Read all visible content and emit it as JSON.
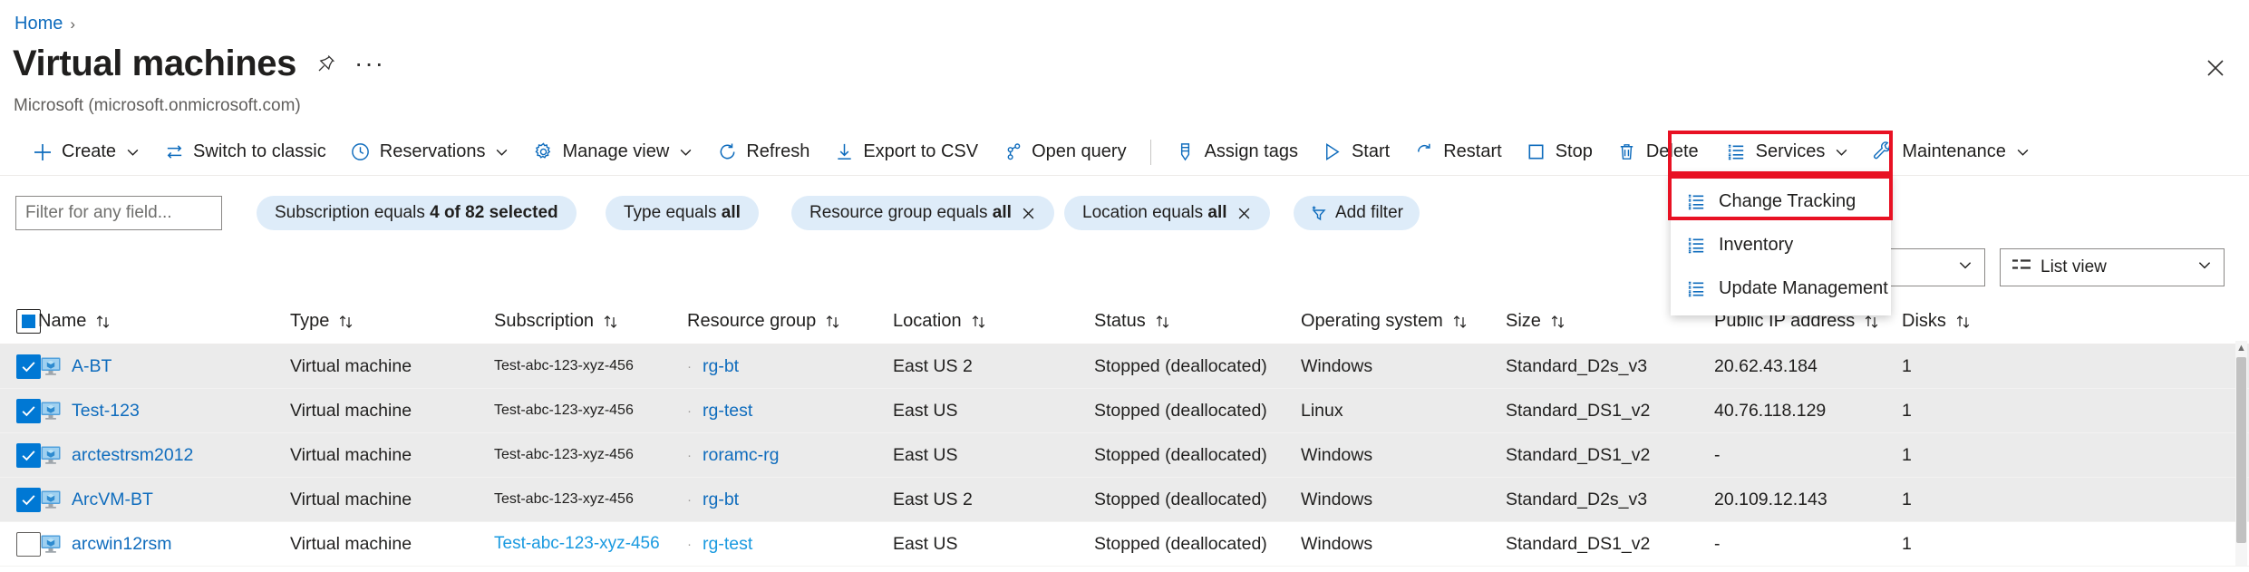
{
  "breadcrumb": {
    "home": "Home",
    "separator": "›"
  },
  "header": {
    "title": "Virtual machines",
    "subtitle": "Microsoft (microsoft.onmicrosoft.com)",
    "pin_icon": "pin-icon",
    "more_icon": "ellipsis-icon",
    "close_icon": "close-icon"
  },
  "toolbar": {
    "items": [
      {
        "label": "Create",
        "icon": "plus-icon",
        "chevron": true
      },
      {
        "label": "Switch to classic",
        "icon": "switch-icon",
        "chevron": false
      },
      {
        "label": "Reservations",
        "icon": "clock-icon",
        "chevron": true
      },
      {
        "label": "Manage view",
        "icon": "gear-icon",
        "chevron": true
      },
      {
        "label": "Refresh",
        "icon": "refresh-icon",
        "chevron": false
      },
      {
        "label": "Export to CSV",
        "icon": "download-icon",
        "chevron": false
      },
      {
        "label": "Open query",
        "icon": "query-icon",
        "chevron": false
      },
      {
        "label": "Assign tags",
        "icon": "tag-icon",
        "chevron": false
      },
      {
        "label": "Start",
        "icon": "play-icon",
        "chevron": false
      },
      {
        "label": "Restart",
        "icon": "restart-icon",
        "chevron": false
      },
      {
        "label": "Stop",
        "icon": "stop-icon",
        "chevron": false
      },
      {
        "label": "Delete",
        "icon": "trash-icon",
        "chevron": false
      },
      {
        "label": "Services",
        "icon": "list-icon",
        "chevron": true
      },
      {
        "label": "Maintenance",
        "icon": "wrench-icon",
        "chevron": true
      }
    ]
  },
  "services_menu": {
    "open": true,
    "highlight_color": "#e81123",
    "items": [
      {
        "label": "Change Tracking",
        "icon": "list-icon",
        "highlighted": true
      },
      {
        "label": "Inventory",
        "icon": "list-icon",
        "highlighted": false
      },
      {
        "label": "Update Management",
        "icon": "list-icon",
        "highlighted": false
      }
    ]
  },
  "filters": {
    "search_placeholder": "Filter for any field...",
    "search_value": "",
    "pills": [
      {
        "prefix": "Subscription equals ",
        "value": "4 of 82 selected",
        "removable": false
      },
      {
        "prefix": "Type equals ",
        "value": "all",
        "removable": false
      },
      {
        "prefix": "Resource group equals ",
        "value": "all",
        "removable": true
      },
      {
        "prefix": "Location equals ",
        "value": "all",
        "removable": true
      }
    ],
    "add_filter_label": "Add filter"
  },
  "view_controls": {
    "group_by": {
      "value": "",
      "icon": "chevron-down-icon"
    },
    "list_view": {
      "value": "List view",
      "icon": "list-view-icon"
    }
  },
  "table": {
    "select_all_state": "indeterminate",
    "columns": [
      {
        "key": "name",
        "label": "Name"
      },
      {
        "key": "type",
        "label": "Type"
      },
      {
        "key": "sub",
        "label": "Subscription"
      },
      {
        "key": "rg",
        "label": "Resource group"
      },
      {
        "key": "loc",
        "label": "Location"
      },
      {
        "key": "stat",
        "label": "Status"
      },
      {
        "key": "os",
        "label": "Operating system"
      },
      {
        "key": "size",
        "label": "Size"
      },
      {
        "key": "ip",
        "label": "Public IP address"
      },
      {
        "key": "disk",
        "label": "Disks"
      }
    ],
    "rows": [
      {
        "selected": true,
        "name": "A-BT",
        "type": "Virtual machine",
        "sub": "Test-abc-123-xyz-456",
        "rg": "rg-bt",
        "loc": "East US 2",
        "stat": "Stopped (deallocated)",
        "os": "Windows",
        "size": "Standard_D2s_v3",
        "ip": "20.62.43.184",
        "disk": "1"
      },
      {
        "selected": true,
        "name": "Test-123",
        "type": "Virtual machine",
        "sub": "Test-abc-123-xyz-456",
        "rg": "rg-test",
        "loc": "East US",
        "stat": "Stopped (deallocated)",
        "os": "Linux",
        "size": "Standard_DS1_v2",
        "ip": "40.76.118.129",
        "disk": "1"
      },
      {
        "selected": true,
        "name": "arctestrsm2012",
        "type": "Virtual machine",
        "sub": "Test-abc-123-xyz-456",
        "rg": "roramc-rg",
        "loc": "East US",
        "stat": "Stopped (deallocated)",
        "os": "Windows",
        "size": "Standard_DS1_v2",
        "ip": "-",
        "disk": "1"
      },
      {
        "selected": true,
        "name": "ArcVM-BT",
        "type": "Virtual machine",
        "sub": "Test-abc-123-xyz-456",
        "rg": "rg-bt",
        "loc": "East US 2",
        "stat": "Stopped (deallocated)",
        "os": "Windows",
        "size": "Standard_D2s_v3",
        "ip": "20.109.12.143",
        "disk": "1"
      },
      {
        "selected": false,
        "name": "arcwin12rsm",
        "type": "Virtual machine",
        "sub": "Test-abc-123-xyz-456",
        "rg": "rg-test",
        "loc": "East US",
        "stat": "Stopped (deallocated)",
        "os": "Windows",
        "size": "Standard_DS1_v2",
        "ip": "-",
        "disk": "1"
      }
    ]
  },
  "colors": {
    "accent": "#0078d4",
    "link": "#0f6cbd",
    "pill_bg": "#deecf9",
    "selected_row": "#ebebeb",
    "highlight": "#e81123"
  }
}
